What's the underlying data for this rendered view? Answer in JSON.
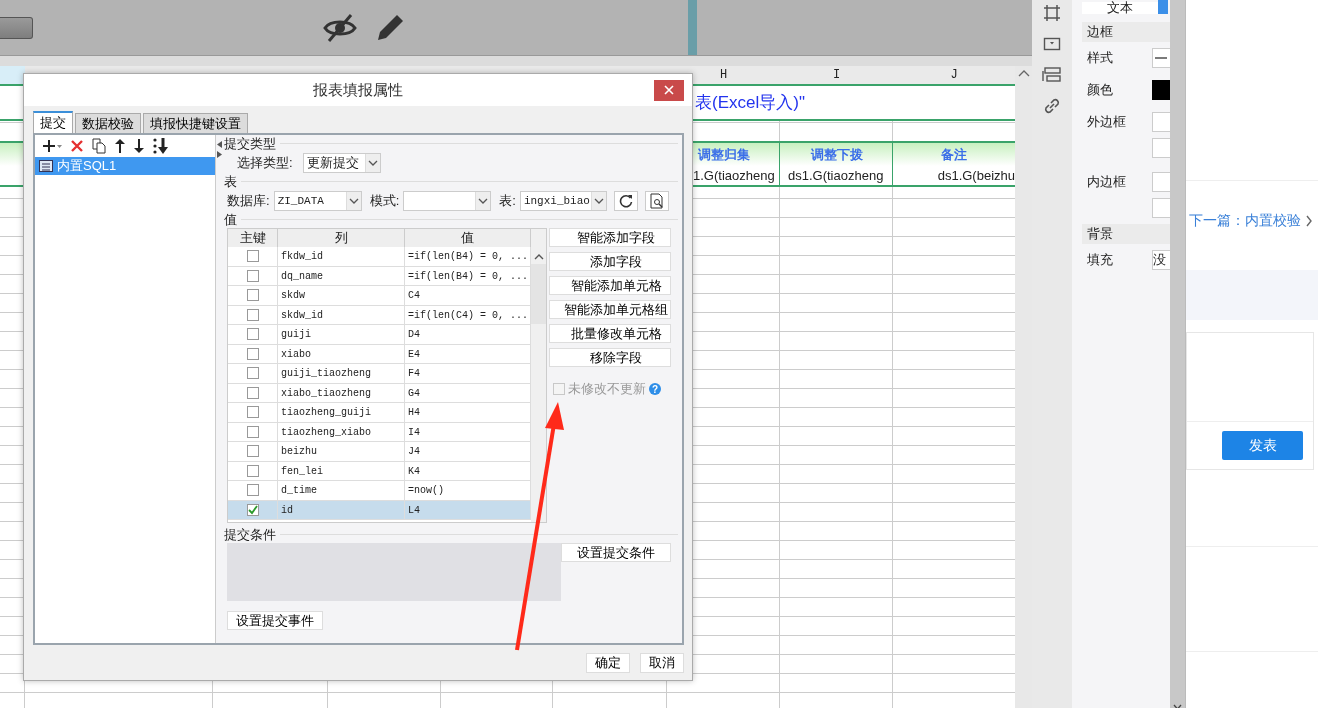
{
  "sheet": {
    "columns": [
      {
        "letter": "H"
      },
      {
        "letter": "I"
      },
      {
        "letter": "J"
      }
    ],
    "title": "表(Excel导入)\"",
    "headers": [
      "调整归集",
      "调整下拨",
      "备注"
    ],
    "cells": [
      "1.G(tiaozheng",
      "ds1.G(tiaozheng",
      "ds1.G(beizhu"
    ]
  },
  "dialog": {
    "title": "报表填报属性",
    "tabs": [
      {
        "label": "提交",
        "selected": true
      },
      {
        "label": "数据校验",
        "selected": false
      },
      {
        "label": "填报快捷键设置",
        "selected": false
      }
    ],
    "items": [
      {
        "label": "内置SQL1",
        "selected": true
      }
    ],
    "submit_type": {
      "label": "提交类型",
      "field_label": "选择类型:",
      "value": "更新提交"
    },
    "table_section": {
      "label": "表",
      "database_label": "数据库:",
      "database": "ZI_DATA",
      "schema_label": "模式:",
      "table_label": "表:",
      "table": "ingxi_biao"
    },
    "values": {
      "label": "值",
      "columns": [
        "主键",
        "列",
        "值"
      ],
      "rows": [
        {
          "key": false,
          "column": "fkdw_id",
          "value": "=if(len(B4) = 0, ...",
          "selected": false
        },
        {
          "key": false,
          "column": "dq_name",
          "value": "=if(len(B4) = 0, ...",
          "selected": false
        },
        {
          "key": false,
          "column": "skdw",
          "value": "C4",
          "selected": false
        },
        {
          "key": false,
          "column": "skdw_id",
          "value": "=if(len(C4) = 0, ...",
          "selected": false
        },
        {
          "key": false,
          "column": "guiji",
          "value": "D4",
          "selected": false
        },
        {
          "key": false,
          "column": "xiabo",
          "value": "E4",
          "selected": false
        },
        {
          "key": false,
          "column": "guiji_tiaozheng",
          "value": "F4",
          "selected": false
        },
        {
          "key": false,
          "column": "xiabo_tiaozheng",
          "value": "G4",
          "selected": false
        },
        {
          "key": false,
          "column": "tiaozheng_guiji",
          "value": "H4",
          "selected": false
        },
        {
          "key": false,
          "column": "tiaozheng_xiabo",
          "value": "I4",
          "selected": false
        },
        {
          "key": false,
          "column": "beizhu",
          "value": "J4",
          "selected": false
        },
        {
          "key": false,
          "column": "fen_lei",
          "value": "K4",
          "selected": false
        },
        {
          "key": false,
          "column": "d_time",
          "value": "=now()",
          "selected": false
        },
        {
          "key": true,
          "column": "id",
          "value": "L4",
          "selected": true
        }
      ]
    },
    "actions": [
      "智能添加字段",
      "添加字段",
      "智能添加单元格",
      "智能添加单元格组",
      "批量修改单元格",
      "移除字段"
    ],
    "skip_unchanged": {
      "label": "未修改不更新",
      "checked": false,
      "disabled": true
    },
    "help": "?",
    "condition": {
      "label": "提交条件",
      "button": "设置提交条件"
    },
    "event_button": "设置提交事件",
    "buttons": [
      "确定",
      "取消"
    ]
  },
  "properties": {
    "text_tab": "文本",
    "border": {
      "title": "边框",
      "style_label": "样式",
      "color_label": "颜色",
      "color": "#000000",
      "outer_label": "外边框",
      "inner_label": "内边框"
    },
    "background": {
      "title": "背景",
      "fill_label": "填充",
      "fill_value": "没"
    }
  },
  "article": {
    "next_link": "下一篇：内置校验",
    "publish_button": "发表"
  }
}
